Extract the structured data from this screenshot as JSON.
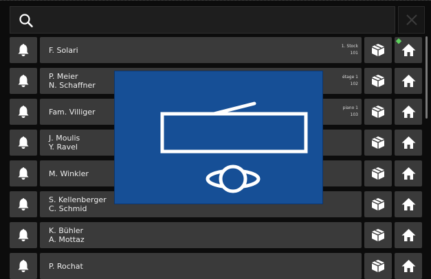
{
  "search": {
    "icon": "search-icon"
  },
  "close": {
    "icon": "close-icon"
  },
  "rows": [
    {
      "names": [
        "F. Solari"
      ],
      "location": [
        "1. Stock",
        "101"
      ],
      "home_status": "online"
    },
    {
      "names": [
        "P. Meier",
        "N. Schaffner"
      ],
      "location": [
        "étage 1",
        "102"
      ]
    },
    {
      "names": [
        "Fam. Villiger"
      ],
      "location": [
        "piano 1",
        "103"
      ]
    },
    {
      "names": [
        "J. Moulis",
        "Y. Ravel"
      ],
      "location": []
    },
    {
      "names": [
        "M. Winkler"
      ],
      "location": []
    },
    {
      "names": [
        "S. Kellenberger",
        "C. Schmid"
      ],
      "location": []
    },
    {
      "names": [
        "K. Bühler",
        "A. Mottaz"
      ],
      "location": []
    },
    {
      "names": [
        "P. Rochat"
      ],
      "location": []
    }
  ],
  "icons": {
    "bell": "bell-icon",
    "package": "package-icon",
    "home": "home-icon"
  },
  "overlay": {
    "icon": "door-open-handset-icon",
    "color": "#164f96"
  },
  "colors": {
    "background": "#0c0c0c",
    "cell": "#3a3a3a",
    "status": "#5fd35f"
  }
}
